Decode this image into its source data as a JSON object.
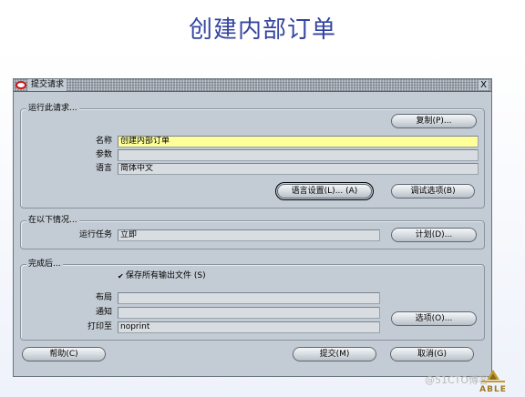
{
  "slide": {
    "title": "创建内部订单"
  },
  "window": {
    "title": "提交请求",
    "close_glyph": "X"
  },
  "run_request": {
    "group_label": "运行此请求...",
    "copy_button": "复制(P)...",
    "name_label": "名称",
    "name_value": "创建内部订单",
    "params_label": "参数",
    "params_value": "",
    "language_label": "语言",
    "language_value": "简体中文",
    "lang_settings_button": "语言设置(L)... (A)",
    "debug_options_button": "调试选项(B)"
  },
  "conditions": {
    "group_label": "在以下情况...",
    "run_job_label": "运行任务",
    "run_job_value": "立即",
    "schedule_button": "计划(D)..."
  },
  "completion": {
    "group_label": "完成后...",
    "save_outputs_label": "保存所有输出文件 (S)",
    "save_outputs_checked": true,
    "layout_label": "布局",
    "layout_value": "",
    "notify_label": "通知",
    "notify_value": "",
    "print_to_label": "打印至",
    "print_to_value": "noprint",
    "options_button": "选项(O)..."
  },
  "footer": {
    "help_button": "帮助(C)",
    "submit_button": "提交(M)",
    "cancel_button": "取消(G)"
  },
  "watermark": {
    "text": "@51CTO博客",
    "logo_text": "ABLE"
  },
  "colors": {
    "title": "#3344a0",
    "window_bg": "#c3ccd4",
    "active_field": "#ffff9a",
    "close_icon_accent": "#d01010"
  }
}
